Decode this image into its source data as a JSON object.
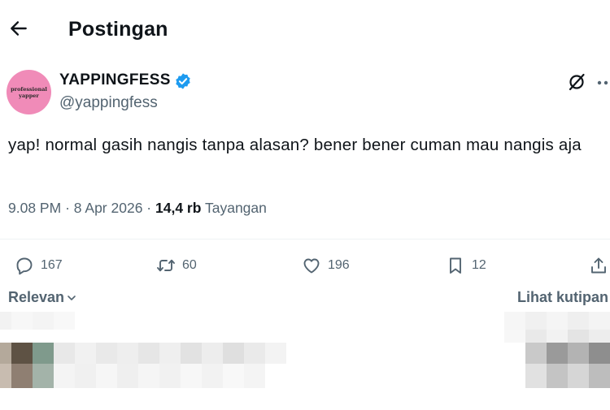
{
  "header": {
    "title": "Postingan"
  },
  "author": {
    "display_name": "YAPPINGFESS",
    "handle": "@yappingfess",
    "avatar_text_line1": "professional",
    "avatar_text_line2": "yapper",
    "avatar_color": "#f08bb8",
    "verified_color": "#1d9bf0"
  },
  "post": {
    "text": "yap! normal gasih nangis tanpa alasan? bener bener cuman mau nangis aja",
    "time": "9.08 PM",
    "date": "8 Apr 2026",
    "views_count": "14,4 rb",
    "views_label": "Tayangan"
  },
  "actions": {
    "replies": "167",
    "reposts": "60",
    "likes": "196",
    "bookmarks": "12"
  },
  "replies_section": {
    "sort_label": "Relevan",
    "quotes_label": "Lihat kutipan"
  },
  "icons": [
    "back-arrow-icon",
    "verified-badge-icon",
    "grok-icon",
    "more-icon",
    "reply-icon",
    "repost-icon",
    "like-icon",
    "bookmark-icon",
    "share-icon",
    "chevron-down-icon"
  ]
}
